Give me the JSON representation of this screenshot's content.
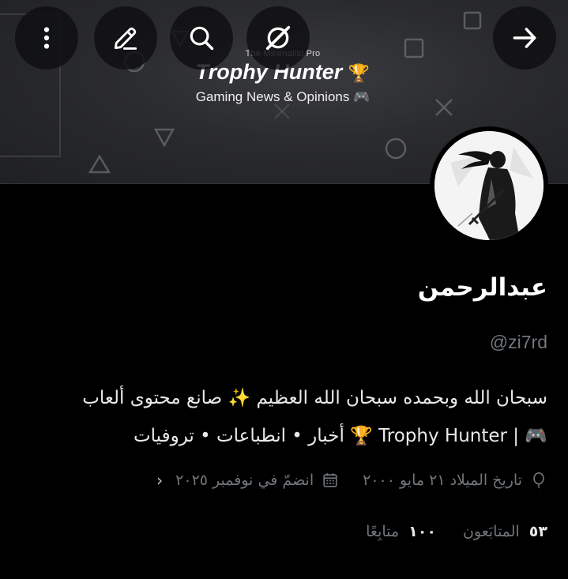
{
  "banner": {
    "brand_small": "The Minimalist Pro",
    "brand_title": "Trophy Hunter",
    "brand_title_emoji": "🏆",
    "brand_subtitle": "Gaming News & Opinions",
    "brand_subtitle_emoji": "🎮"
  },
  "toolbar": {
    "more_icon": "more-vertical-icon",
    "edit_icon": "pencil-icon",
    "search_icon": "search-icon",
    "grok_icon": "grok-icon",
    "back_icon": "arrow-back-icon"
  },
  "profile": {
    "display_name": "عبدالرحمن",
    "handle": "@zi7rd",
    "bio_line1": "سبحان الله وبحمده سبحان الله العظيم ✨ صانع محتوى ألعاب",
    "bio_line2": "🎮 | Trophy Hunter 🏆 أخبار • انطباعات • تروفيات",
    "birthdate": "تاريخ الميلاد ٢١ مايو ٢٠٠٠",
    "joined": "انضمّ في نوفمبر ٢٠٢٥",
    "following_count": "١٠٠",
    "following_label": "متابِعًا",
    "followers_count": "٥٣",
    "followers_label": "المتابَعون"
  },
  "colors": {
    "background": "#000000",
    "text_primary": "#e7e9ea",
    "text_secondary": "#71767b",
    "button_bg": "#0f0f11"
  }
}
